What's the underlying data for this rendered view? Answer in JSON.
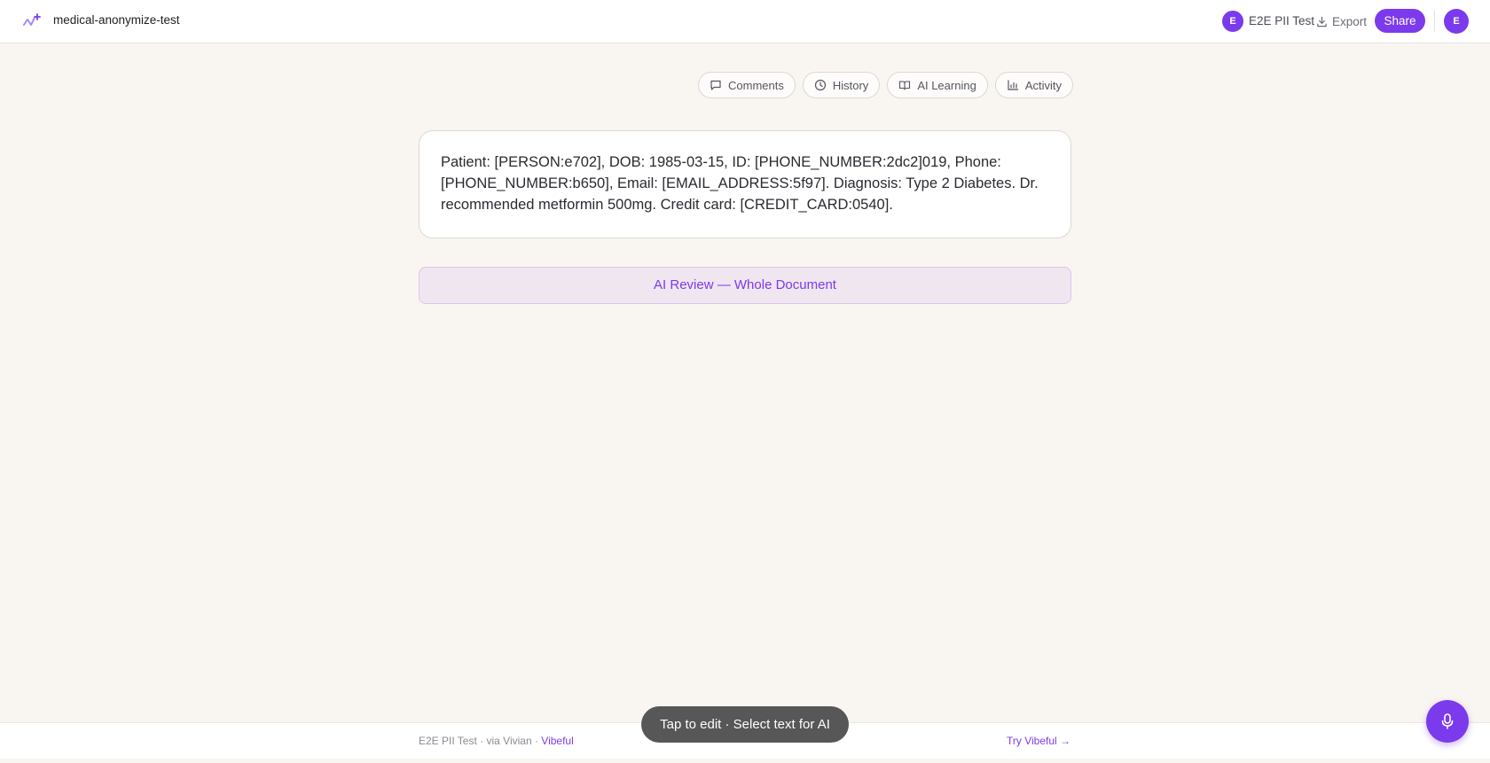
{
  "header": {
    "logo_icon": "sparkle-wave-logo",
    "doc_title": "medical-anonymize-test",
    "collaborator": {
      "initial": "E",
      "name": "E2E PII Test"
    },
    "export_label": "Export",
    "share_label": "Share",
    "user_initial": "E"
  },
  "toolbar": {
    "comments": "Comments",
    "history": "History",
    "ai_learning": "AI Learning",
    "activity": "Activity"
  },
  "document": {
    "text": "Patient: [PERSON:e702], DOB: 1985-03-15, ID: [PHONE_NUMBER:2dc2]019, Phone: [PHONE_NUMBER:b650], Email: [EMAIL_ADDRESS:5f97]. Diagnosis: Type 2 Diabetes. Dr. recommended metformin 500mg. Credit card: [CREDIT_CARD:0540]."
  },
  "ai_review": {
    "label": "AI Review — Whole Document"
  },
  "footer": {
    "left_text": "E2E PII Test · via Vivian · ",
    "brand": "Vibeful",
    "cta": "Try Vibeful →"
  },
  "toast": {
    "text": "Tap to edit · Select text for AI"
  },
  "colors": {
    "accent": "#7c3aed",
    "background": "#f9f6f1"
  }
}
